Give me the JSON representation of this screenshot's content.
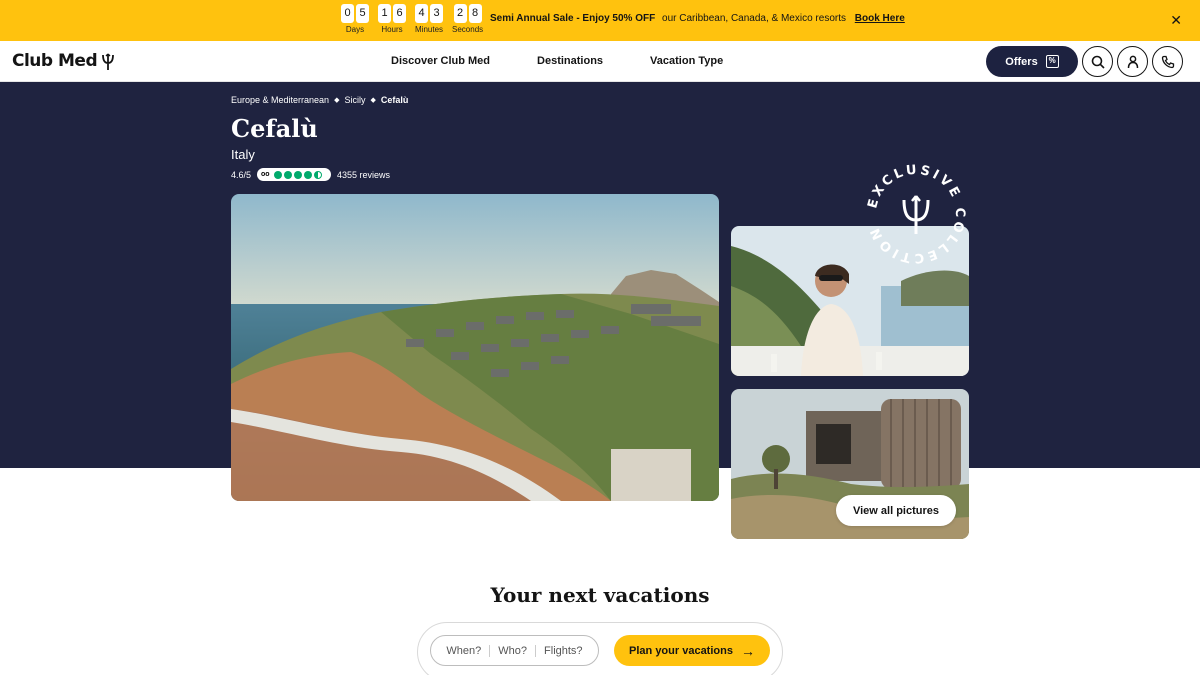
{
  "promo": {
    "countdown": [
      {
        "digits": [
          "0",
          "5"
        ],
        "label": "Days"
      },
      {
        "digits": [
          "1",
          "6"
        ],
        "label": "Hours"
      },
      {
        "digits": [
          "4",
          "3"
        ],
        "label": "Minutes"
      },
      {
        "digits": [
          "2",
          "8"
        ],
        "label": "Seconds"
      }
    ],
    "headline": "Semi Annual Sale - Enjoy 50% OFF",
    "subtext": "our Caribbean, Canada, & Mexico resorts",
    "cta": "Book Here",
    "close": "✕",
    "bg_color": "#ffc20e"
  },
  "header": {
    "logo_text": "Club Med",
    "nav": [
      "Discover Club Med",
      "Destinations",
      "Vacation Type"
    ],
    "offers_label": "Offers",
    "offers_icon": "%",
    "icons": [
      "search-icon",
      "user-icon",
      "phone-icon"
    ],
    "brand_color": "#1d2240"
  },
  "hero": {
    "breadcrumb": [
      "Europe & Mediterranean",
      "Sicily",
      "Cefalù"
    ],
    "title": "Cefalù",
    "country": "Italy",
    "rating": "4.6/5",
    "tripadvisor_score": 4.5,
    "reviews": "4355 reviews",
    "view_all": "View all pictures",
    "badge_text": "EXCLUSIVE COLLECTION",
    "bg_color": "#1f2340"
  },
  "booking": {
    "title": "Your next vacations",
    "when": "When?",
    "who": "Who?",
    "flights": "Flights?",
    "plan_label": "Plan your vacations",
    "plan_icon": "→"
  }
}
